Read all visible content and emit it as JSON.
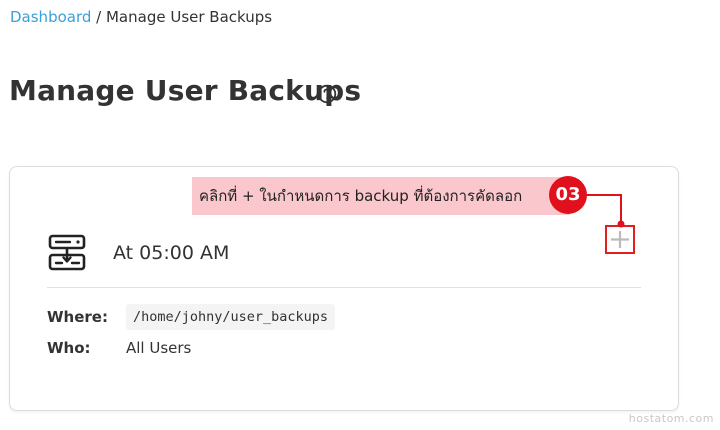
{
  "breadcrumb": {
    "home_label": "Dashboard",
    "separator": " / ",
    "current_label": "Manage User Backups"
  },
  "page": {
    "title": "Manage User Backups",
    "help_icon": "help-circle-icon"
  },
  "backup_card": {
    "icon": "server-backup-icon",
    "schedule_time": "At 05:00 AM",
    "add_icon": "plus-icon",
    "where_label": "Where:",
    "where_value": "/home/johny/user_backups",
    "who_label": "Who:",
    "who_value": "All Users"
  },
  "annotation": {
    "text": "คลิกที่ + ในกำหนดการ backup ที่ต้องการคัดลอก",
    "step_number": "03",
    "color": "#e0101c",
    "bg_color": "#f9c7cc"
  },
  "watermark": "hostatom.com",
  "colors": {
    "link": "#3aa0d8",
    "text": "#333333",
    "accent_red": "#e02020"
  }
}
